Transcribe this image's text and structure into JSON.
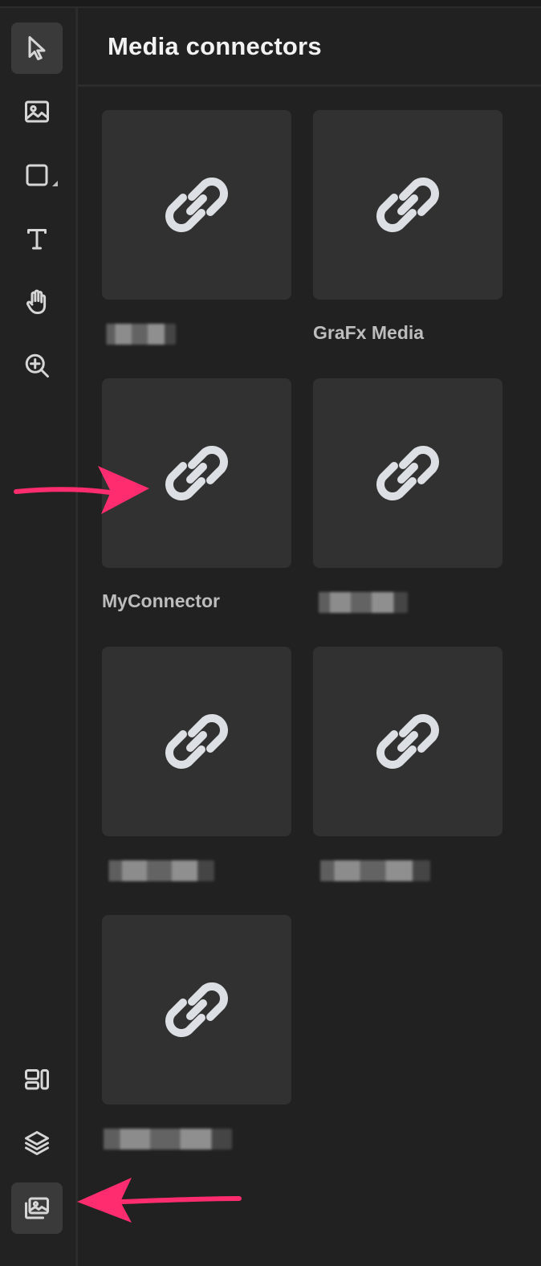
{
  "panel": {
    "title": "Media connectors"
  },
  "toolbar": {
    "tools": [
      {
        "name": "select-tool",
        "icon": "cursor-icon",
        "active": true
      },
      {
        "name": "image-tool",
        "icon": "image-icon",
        "active": false
      },
      {
        "name": "shape-tool",
        "icon": "square-icon",
        "active": false
      },
      {
        "name": "text-tool",
        "icon": "text-icon",
        "active": false
      },
      {
        "name": "hand-tool",
        "icon": "hand-icon",
        "active": false
      },
      {
        "name": "zoom-tool",
        "icon": "zoom-in-icon",
        "active": false
      }
    ],
    "bottom_tools": [
      {
        "name": "layouts-tool",
        "icon": "layouts-icon",
        "active": false
      },
      {
        "name": "layers-tool",
        "icon": "layers-icon",
        "active": false
      },
      {
        "name": "media-tool",
        "icon": "media-icon",
        "active": true
      }
    ]
  },
  "connectors": [
    {
      "label": "",
      "redacted": true
    },
    {
      "label": "GraFx Media",
      "redacted": false
    },
    {
      "label": "MyConnector",
      "redacted": false
    },
    {
      "label": "",
      "redacted": true
    },
    {
      "label": "",
      "redacted": true
    },
    {
      "label": "",
      "redacted": true
    },
    {
      "label": "",
      "redacted": true
    }
  ],
  "colors": {
    "background": "#212121",
    "card": "#313131",
    "link_icon": "#dcdfe3",
    "annotation_arrow": "#ff2d6f",
    "active_tool": "#3a3a3a"
  }
}
